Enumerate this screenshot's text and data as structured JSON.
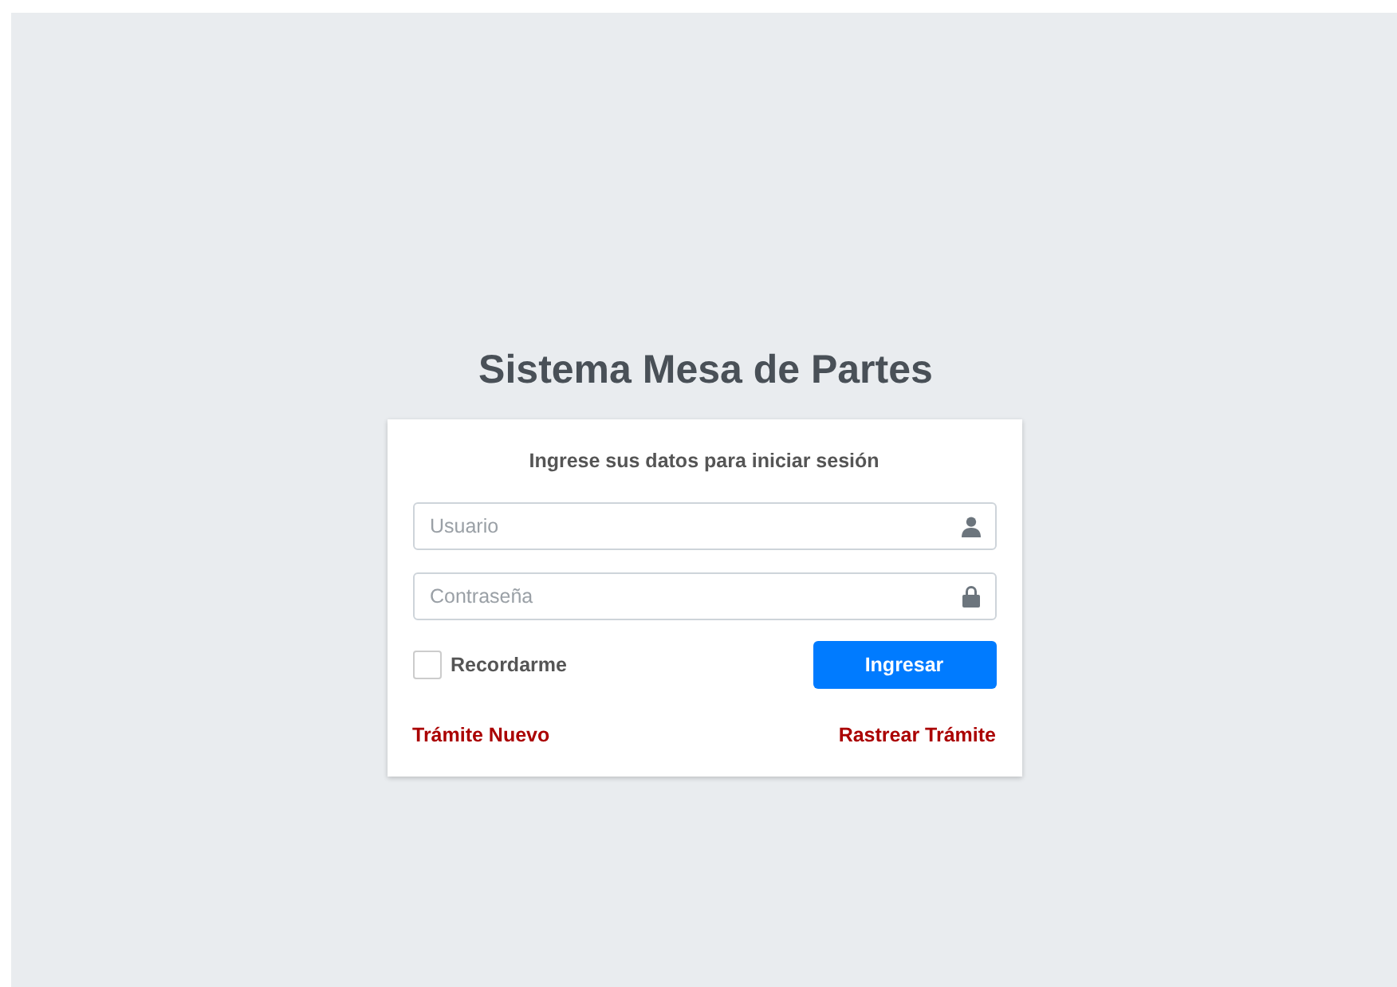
{
  "title": "Sistema Mesa de Partes",
  "subtitle": "Ingrese sus datos para iniciar sesión",
  "fields": [
    {
      "placeholder": "Usuario",
      "kind": "user"
    },
    {
      "placeholder": "Contraseña",
      "kind": "password"
    }
  ],
  "remember": {
    "label": "Recordarme",
    "checked": false
  },
  "submit": "Ingresar",
  "links": [
    "Trámite Nuevo",
    "Rastrear Trámite"
  ]
}
